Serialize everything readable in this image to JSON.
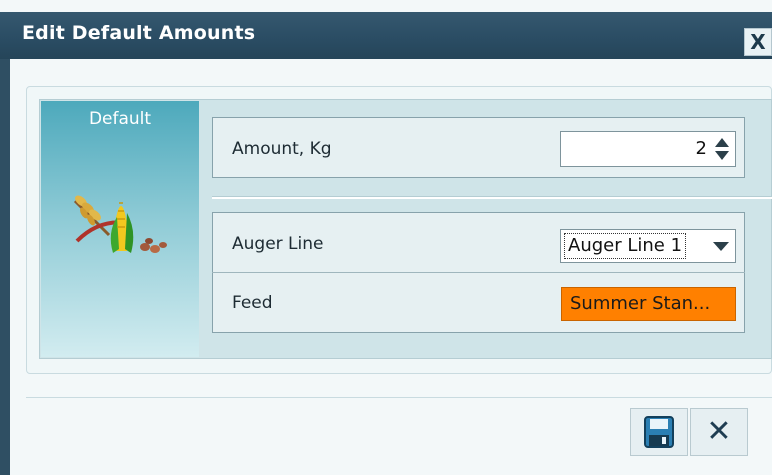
{
  "dialog": {
    "title": "Edit Default Amounts",
    "close_glyph": "X",
    "close_icon": "close-icon"
  },
  "sidebar": {
    "label": "Default",
    "icon": "feed-grain-icon"
  },
  "fields": {
    "amount": {
      "label": "Amount, Kg",
      "value": "2"
    },
    "auger_line": {
      "label": "Auger Line",
      "selected": "Auger Line 1"
    },
    "feed": {
      "label": "Feed",
      "value": "Summer Stan..."
    }
  },
  "buttons": {
    "save_icon": "save-icon",
    "cancel_glyph": "✕",
    "cancel_icon": "close-icon"
  },
  "colors": {
    "titlebar": "#2a4c63",
    "feed_highlight": "#ff8000",
    "sidebar_top": "#4da9bc"
  }
}
